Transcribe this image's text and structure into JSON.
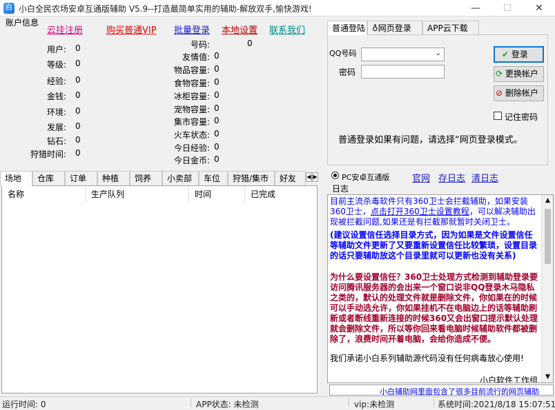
{
  "window": {
    "title": "小白全民农场安卓互通版辅助 V5.9--打造最简单实用的辅助-解放双手,愉快游戏!",
    "min_glyph": "—",
    "max_glyph": "☐",
    "close_glyph": "✕"
  },
  "account": {
    "group_title": "账户信息",
    "links": [
      "云挂注册",
      "购买普通VIP",
      "批量登录",
      "本地设置",
      "联系我们"
    ],
    "left_fields": [
      {
        "label": "用户:",
        "value": "0"
      },
      {
        "label": "等级:",
        "value": "0"
      },
      {
        "label": "经验:",
        "value": "0"
      },
      {
        "label": "金钱:",
        "value": "0"
      },
      {
        "label": "环境:",
        "value": "0"
      },
      {
        "label": "发展:",
        "value": "0"
      },
      {
        "label": "钻石:",
        "value": "0"
      },
      {
        "label": "狩猎时间:",
        "value": "0"
      }
    ],
    "right_fields": [
      {
        "label": "号码:",
        "value": "0"
      },
      {
        "label": "友情值:",
        "value": "0"
      },
      {
        "label": "物品容量:",
        "value": "0"
      },
      {
        "label": "食物容量:",
        "value": "0"
      },
      {
        "label": "冰柜容量:",
        "value": "0"
      },
      {
        "label": "宠物容量:",
        "value": "0"
      },
      {
        "label": "集市容量:",
        "value": "0"
      },
      {
        "label": "火车状态:",
        "value": "0"
      },
      {
        "label": "今日经验:",
        "value": "0"
      },
      {
        "label": "今日金币:",
        "value": "0"
      }
    ]
  },
  "bottom_tabs": {
    "tabs": [
      "场地",
      "仓库",
      "订单",
      "种植",
      "饲养",
      "小卖部",
      "车位",
      "狩猎/集市",
      "好友"
    ],
    "columns": [
      "名称",
      "生产队列",
      "时间",
      "已完成"
    ]
  },
  "login": {
    "tabs": [
      "普通登陆",
      "网页登录",
      "APP云下载"
    ],
    "qq_label": "QQ号码",
    "qq_value": "",
    "password_label": "密码",
    "password_value": "",
    "login_button": "登录",
    "switch_button": "更换帐户",
    "delete_button": "删除帐户",
    "remember_label": "记住密码",
    "hint": "普通登录如果有问题，请选择“网页登录模式。"
  },
  "mode": {
    "radio_label": "PC安卓互通版",
    "links": [
      "官网",
      "存日志",
      "清日志"
    ]
  },
  "log": {
    "title": "日志",
    "colors": {
      "blue": "#0000ff",
      "red": "#a0002a",
      "black": "#000000"
    },
    "lines": [
      {
        "text": "目前主流杀毒软件只有360卫士会拦截辅助，如果安装360卫士，",
        "color": "blue",
        "link": "点击打开360卫士设置教程",
        "after": "，可以解决辅助出现被拦截问题,如果还是有拦截那就暂时关闭卫士。"
      },
      {
        "text": "(建议设置信任选择目录方式，因为如果是文件设置信任等辅助文件更新了又要重新设置信任比较繁琐，设置目录的话只要辅助放这个目录里就可以更新也没有关系)",
        "color": "blue"
      },
      {
        "text": "为什么要设置信任？360卫士处理方式检测到辅助登录要访问腾讯服务器的会出来一个窗口说非QQ登录木马隐私之类的，默认的处理文件就是删除文件，你如果在的时候可以手动选允许，你如果挂机不在电脑边上的话等辅助刷新或者断线重新连接的时候360又会出窗口提示默认处理就会删除文件，所以等你回来看电脑时候辅助软件都被删除了，浪费时间开着电脑，会给你造成不便。",
        "color": "red"
      },
      {
        "text": "我们承诺小白系列辅助源代码没有任何病毒放心使用!",
        "color": "black"
      },
      {
        "text": "小白软件工作组",
        "color": "black"
      }
    ],
    "marquee": "小白辅助网里面包含了很多目前流行的网页辅助"
  },
  "status": {
    "run_time": "运行时间: 0",
    "app_status": "APP状态: 未检测",
    "vip": "vip:未检测",
    "sys_time": "系统时间:2021/8/18 15:07:51"
  }
}
